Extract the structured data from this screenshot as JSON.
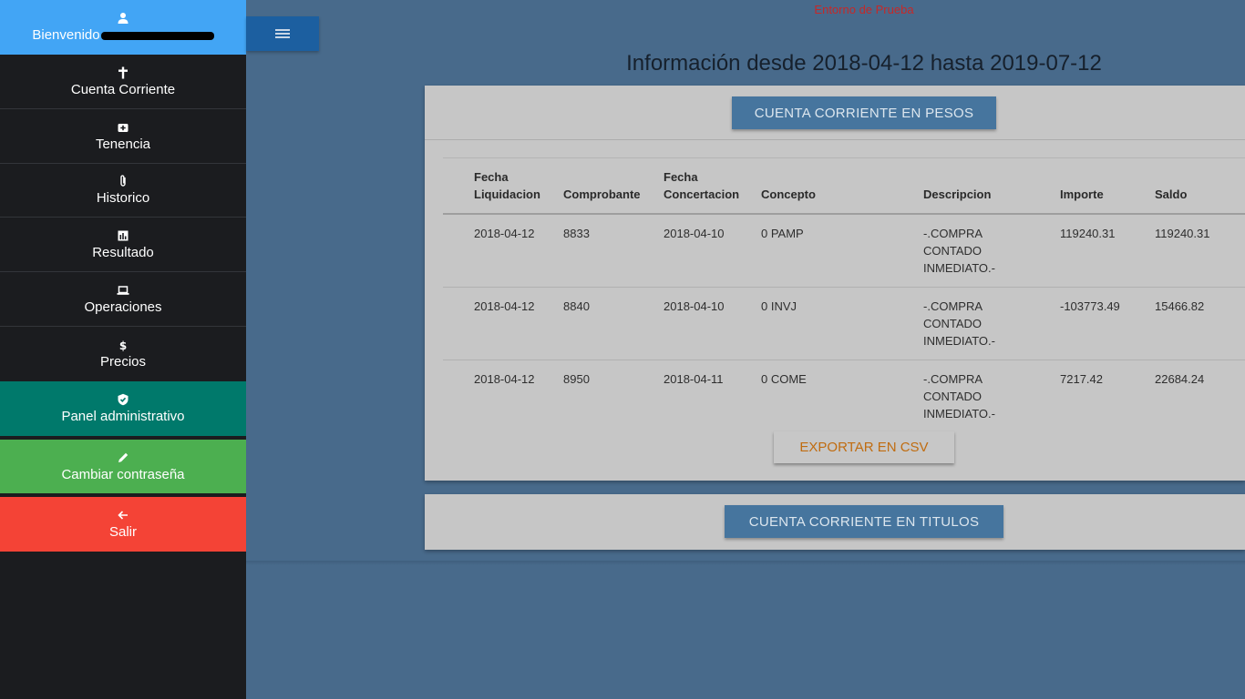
{
  "sidebar": {
    "welcome_label": "Bienvenido",
    "items": [
      {
        "label": "Cuenta Corriente",
        "icon": "cross-icon"
      },
      {
        "label": "Tenencia",
        "icon": "medkit-icon"
      },
      {
        "label": "Historico",
        "icon": "paperclip-icon"
      },
      {
        "label": "Resultado",
        "icon": "bar-chart-icon"
      },
      {
        "label": "Operaciones",
        "icon": "laptop-icon"
      },
      {
        "label": "Precios",
        "icon": "dollar-icon"
      }
    ],
    "admin_label": "Panel administrativo",
    "password_label": "Cambiar contraseña",
    "logout_label": "Salir"
  },
  "header": {
    "environment": "Entorno de Prueba",
    "title_prefix": "Información desde",
    "date_from": "2018-04-12",
    "title_mid": "hasta",
    "date_to": "2019-07-12"
  },
  "pesos_panel": {
    "button_label": "CUENTA CORRIENTE EN PESOS",
    "columns": [
      [
        "Fecha",
        "Liquidacion"
      ],
      [
        "",
        "Comprobante"
      ],
      [
        "Fecha",
        "Concertacion"
      ],
      [
        "",
        "Concepto"
      ],
      [
        "",
        "Descripcion"
      ],
      [
        "",
        "Importe"
      ],
      [
        "",
        "Saldo"
      ]
    ],
    "rows": [
      {
        "fecha_liq": "2018-04-12",
        "comprobante": "8833",
        "fecha_conc": "2018-04-10",
        "concepto": "0 PAMP",
        "desc": [
          "-.COMPRA",
          "CONTADO",
          "INMEDIATO.-"
        ],
        "importe": "119240.31",
        "saldo": "119240.31"
      },
      {
        "fecha_liq": "2018-04-12",
        "comprobante": "8840",
        "fecha_conc": "2018-04-10",
        "concepto": "0 INVJ",
        "desc": [
          "-.COMPRA",
          "CONTADO",
          "INMEDIATO.-"
        ],
        "importe": "-103773.49",
        "saldo": "15466.82"
      },
      {
        "fecha_liq": "2018-04-12",
        "comprobante": "8950",
        "fecha_conc": "2018-04-11",
        "concepto": "0 COME",
        "desc": [
          "-.COMPRA",
          "CONTADO",
          "INMEDIATO.-"
        ],
        "importe": "7217.42",
        "saldo": "22684.24"
      }
    ],
    "export_label": "EXPORTAR EN CSV"
  },
  "titulos_panel": {
    "button_label": "CUENTA CORRIENTE EN TITULOS"
  }
}
